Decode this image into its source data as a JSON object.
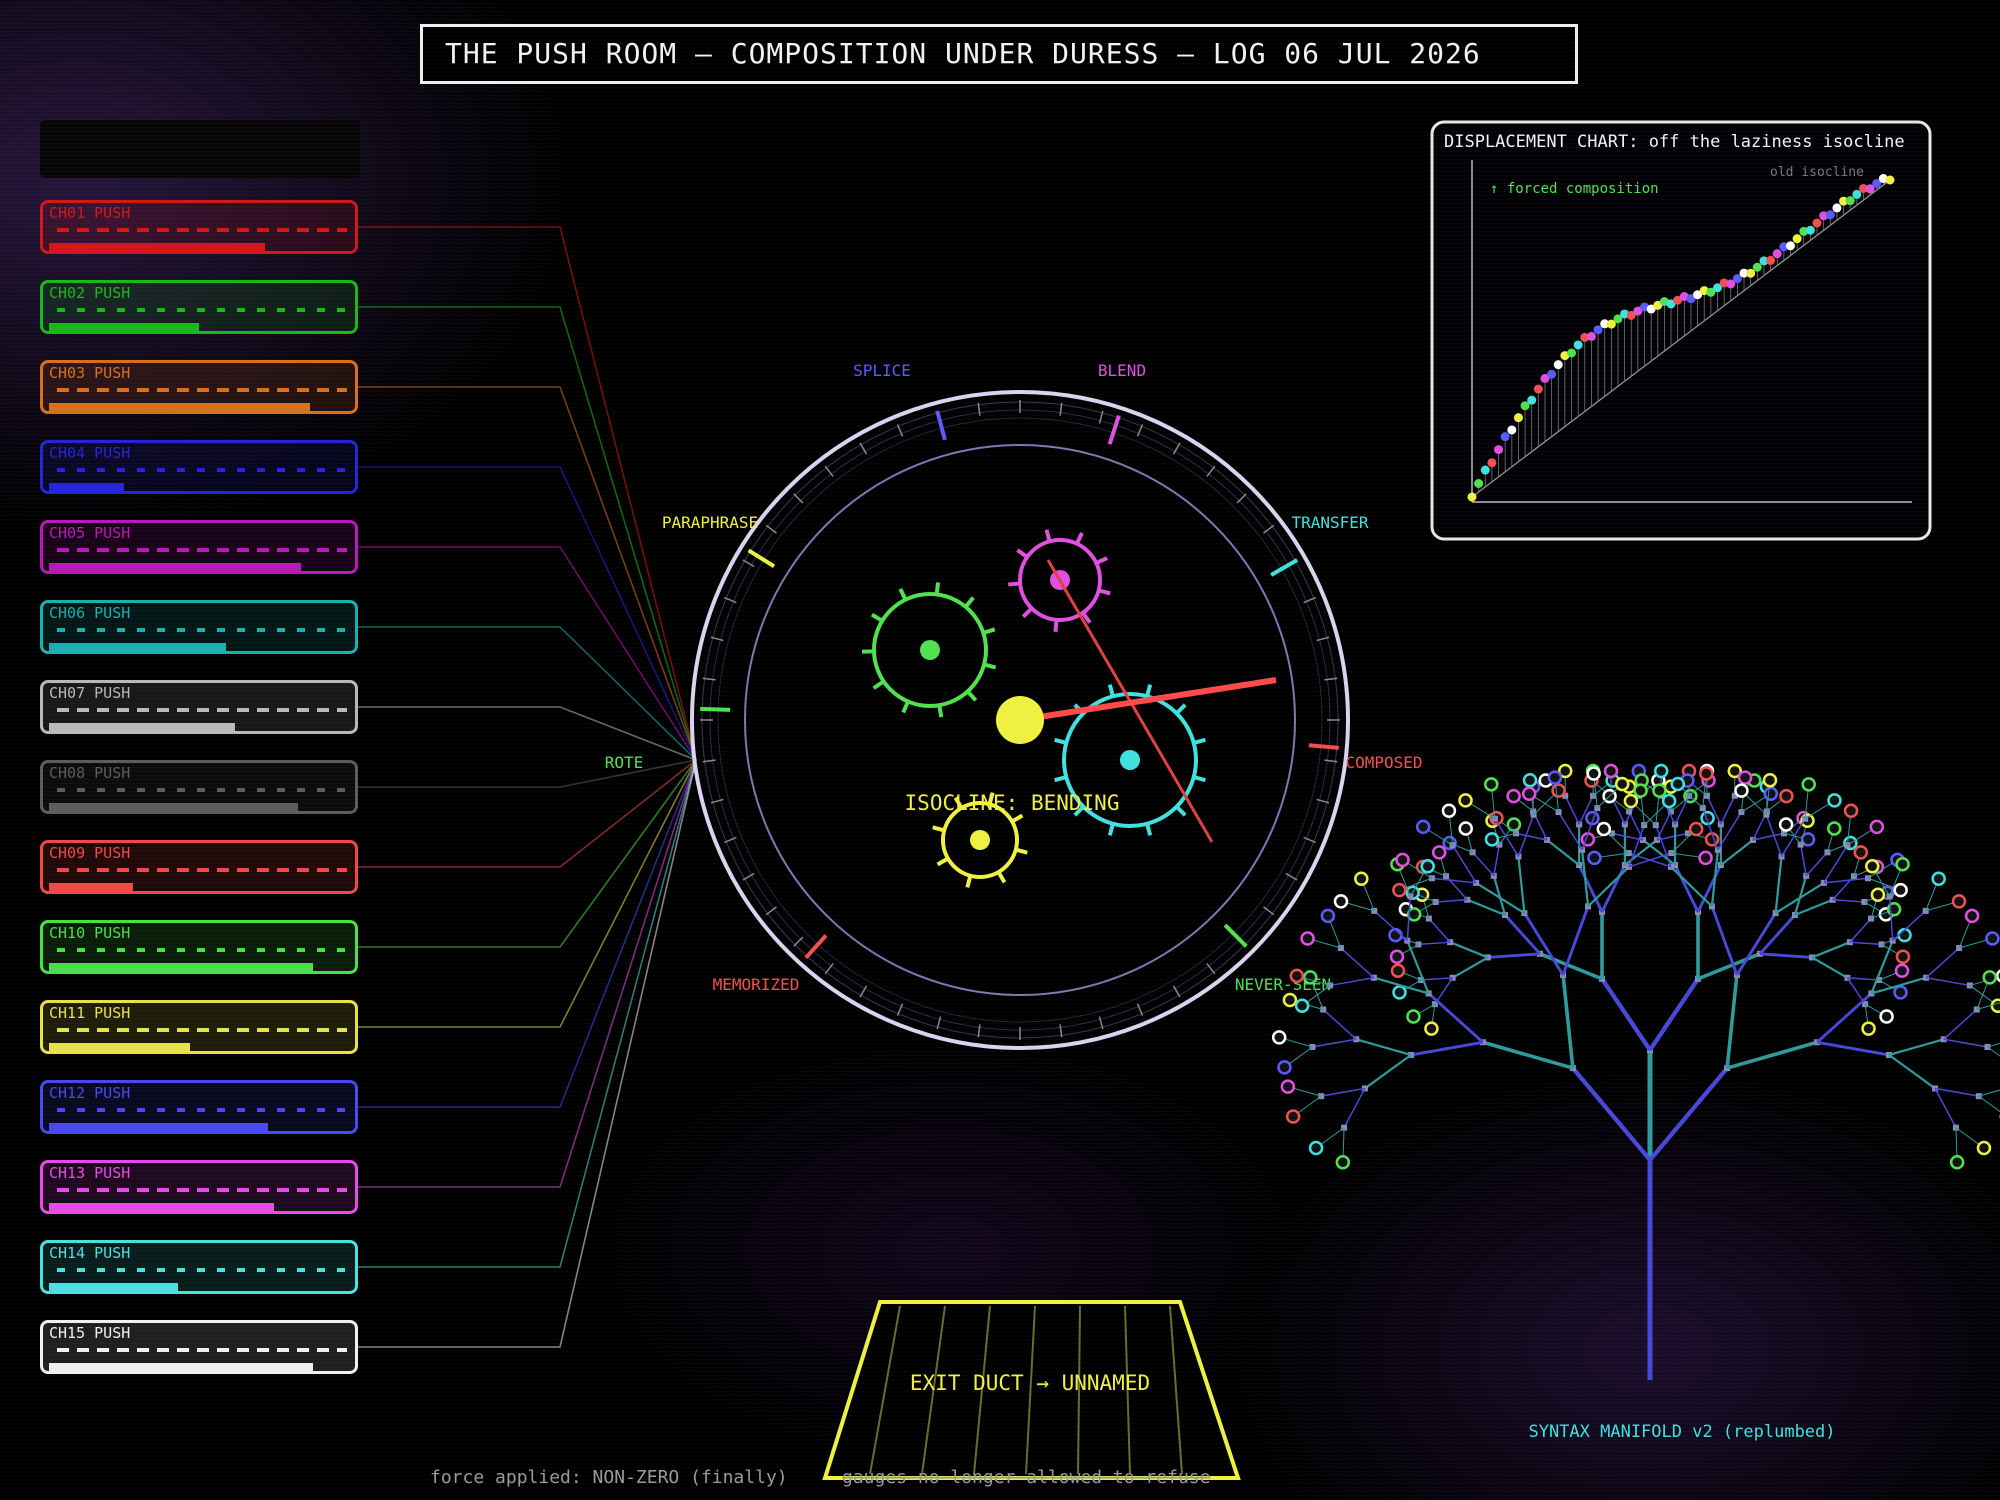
{
  "title": "THE PUSH ROOM — COMPOSITION UNDER DURESS — LOG 06 JUL 2026",
  "channels": [
    {
      "label": "CH01 PUSH",
      "color": "#d01818",
      "level": 0.72
    },
    {
      "label": "CH02 PUSH",
      "color": "#18b818",
      "level": 0.5
    },
    {
      "label": "CH03 PUSH",
      "color": "#d8701a",
      "level": 0.87
    },
    {
      "label": "CH04 PUSH",
      "color": "#2424d8",
      "level": 0.25
    },
    {
      "label": "CH05 PUSH",
      "color": "#b818b8",
      "level": 0.84
    },
    {
      "label": "CH06 PUSH",
      "color": "#18b0b0",
      "level": 0.59
    },
    {
      "label": "CH07 PUSH",
      "color": "#b8b8b8",
      "level": 0.62
    },
    {
      "label": "CH08 PUSH",
      "color": "#5c5c5c",
      "level": 0.83
    },
    {
      "label": "CH09 PUSH",
      "color": "#f04848",
      "level": 0.28
    },
    {
      "label": "CH10 PUSH",
      "color": "#48e048",
      "level": 0.88
    },
    {
      "label": "CH11 PUSH",
      "color": "#e8e048",
      "level": 0.47
    },
    {
      "label": "CH12 PUSH",
      "color": "#4848f0",
      "level": 0.73
    },
    {
      "label": "CH13 PUSH",
      "color": "#e848e8",
      "level": 0.75
    },
    {
      "label": "CH14 PUSH",
      "color": "#48e0e0",
      "level": 0.43
    },
    {
      "label": "CH15 PUSH",
      "color": "#f0f0f0",
      "level": 0.88
    }
  ],
  "dial": {
    "labels": [
      {
        "text": "SPLICE",
        "color": "#5a5aff"
      },
      {
        "text": "BLEND",
        "color": "#e050e0"
      },
      {
        "text": "PARAPHRASE",
        "color": "#f0f040"
      },
      {
        "text": "TRANSFER",
        "color": "#40e0e0"
      },
      {
        "text": "ROTE",
        "color": "#50e050"
      },
      {
        "text": "COMPOSED",
        "color": "#f05050"
      },
      {
        "text": "MEMORIZED",
        "color": "#f05050"
      },
      {
        "text": "NEVER-SEEN",
        "color": "#50e050"
      }
    ],
    "status": "ISOCLINE: BENDING"
  },
  "displacement": {
    "title": "DISPLACEMENT CHART: off the laziness isocline",
    "annotation": "↑ forced composition",
    "legend": "old isocline"
  },
  "tree": {
    "label": "SYNTAX MANIFOLD v2 (replumbed)"
  },
  "exit_duct": {
    "label": "EXIT DUCT → UNNAMED"
  },
  "footer": {
    "left": "force applied: NON-ZERO (finally)",
    "right": "gauges no longer allowed to refuse"
  },
  "colors": {
    "accent_yellow": "#f0f040",
    "needle": "#ff4a4a",
    "ring": "#d8d4f0"
  }
}
